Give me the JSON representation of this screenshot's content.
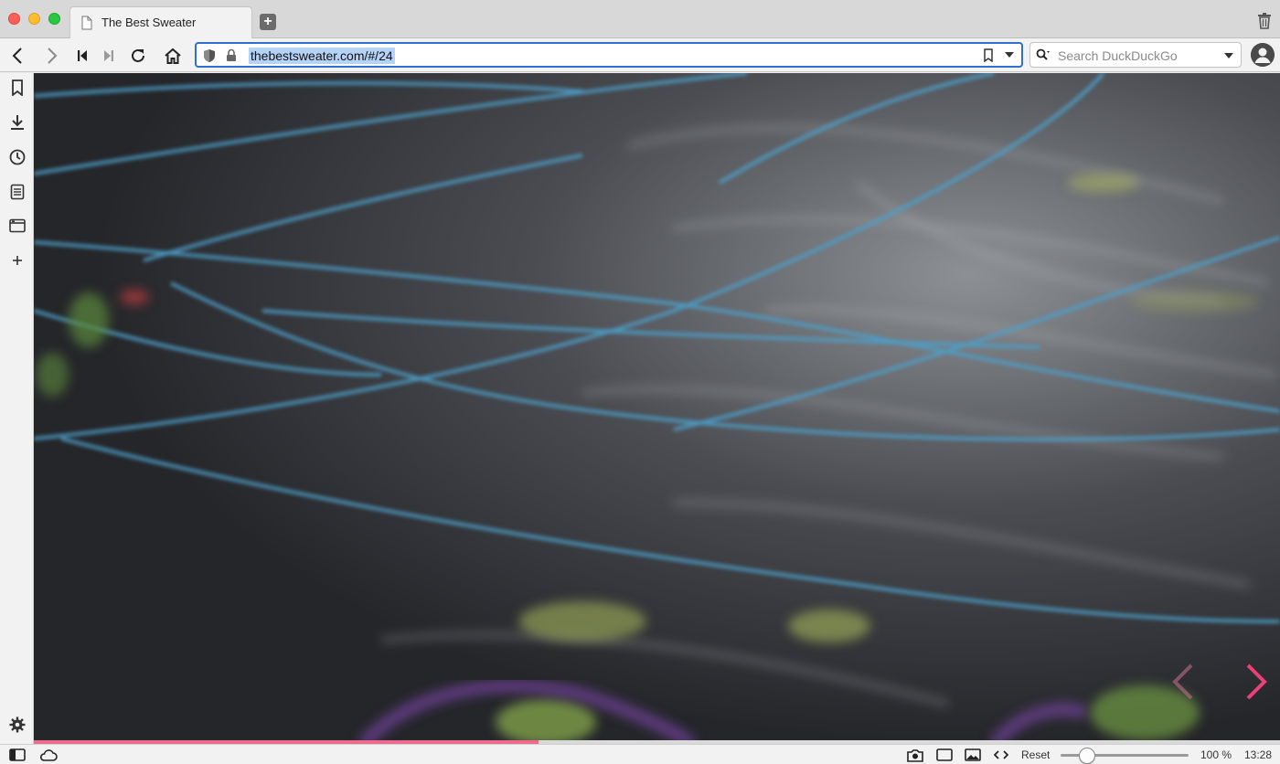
{
  "tab": {
    "title": "The Best Sweater"
  },
  "address": {
    "url": "thebestsweater.com/#/24"
  },
  "search": {
    "placeholder": "Search DuckDuckGo"
  },
  "slideshow": {
    "progress_fraction": 0.405
  },
  "status": {
    "reset_label": "Reset",
    "zoom_label": "100 %",
    "zoom_fraction": 0.21,
    "clock": "13:28"
  },
  "colors": {
    "accent": "#f06a8e",
    "url_focus": "#2f6fd1",
    "url_selection": "#b4d3f7"
  },
  "icons": {
    "toolbar": [
      "back-icon",
      "forward-icon",
      "rewind-icon",
      "fast-forward-icon",
      "reload-icon",
      "home-icon"
    ],
    "sidepanel": [
      "bookmarks-icon",
      "downloads-icon",
      "history-icon",
      "notes-icon",
      "window-icon",
      "add-panel-icon",
      "settings-icon"
    ],
    "statusbar": [
      "panel-toggle-icon",
      "sync-cloud-icon",
      "capture-icon",
      "tiling-icon",
      "images-icon",
      "page-actions-icon"
    ]
  }
}
